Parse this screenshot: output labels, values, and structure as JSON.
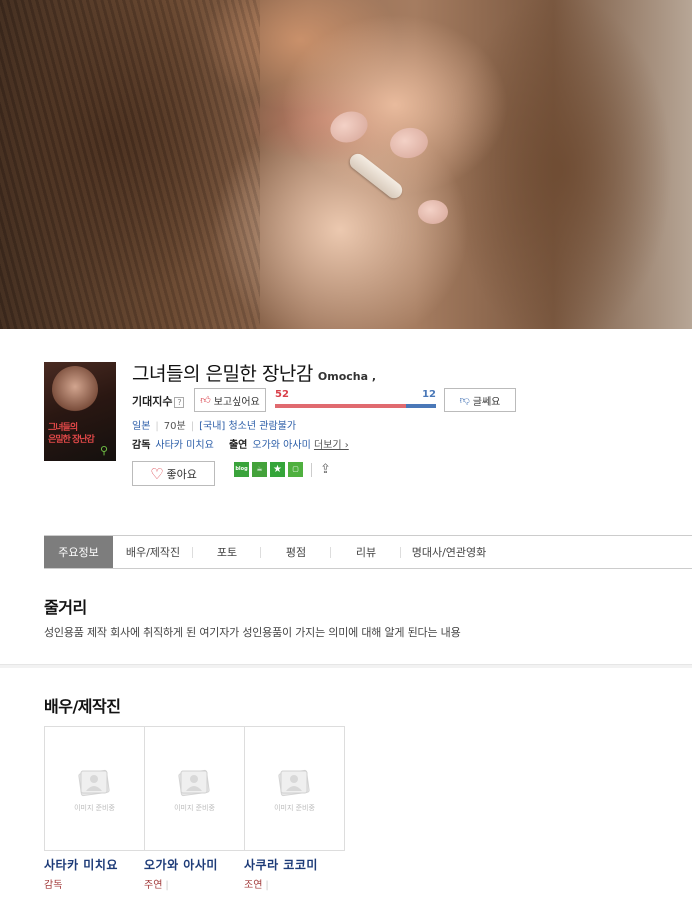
{
  "movie": {
    "title": "그녀들의 은밀한 장난감",
    "original_title": "Omocha ,",
    "poster_text_1": "그녀들의",
    "poster_text_2": "은밀한 장난감",
    "country": "일본",
    "runtime": "70분",
    "rating": "[국내] 청소년 관람불가",
    "director_label": "감독",
    "director": "사타카 미치요",
    "cast_label": "출연",
    "cast_names": "오가와 아사미",
    "more_label": "더보기 ›"
  },
  "expectation": {
    "label": "기대지수",
    "help": "?",
    "want_label": "보고싶어요",
    "dislike_label": "글쎄요",
    "want_count": "52",
    "dislike_count": "12",
    "want_ratio": 0.8125
  },
  "actions": {
    "like_label": "좋아요",
    "share_blog": "blog"
  },
  "tabs": [
    {
      "label": "주요정보"
    },
    {
      "label": "배우/제작진"
    },
    {
      "label": "포토"
    },
    {
      "label": "평점"
    },
    {
      "label": "리뷰"
    },
    {
      "label": "명대사/연관영화"
    }
  ],
  "synopsis": {
    "heading": "줄거리",
    "text": "성인용품 제작 회사에 취직하게 된 여기자가 성인용품이 가지는 의미에 대해 알게 된다는 내용"
  },
  "cast_section": {
    "heading": "배우/제작진",
    "placeholder": "이미지 준비중",
    "members": [
      {
        "name": "사타카 미치요",
        "role": "감독"
      },
      {
        "name": "오가와 아사미",
        "role": "주연"
      },
      {
        "name": "사쿠라 코코미",
        "role": "조연"
      }
    ]
  },
  "colors": {
    "want": "#d9414b",
    "dislike": "#4a78b8",
    "link": "#2c5ea8",
    "cast_name": "#1d3b78",
    "role": "#a23a3a"
  }
}
